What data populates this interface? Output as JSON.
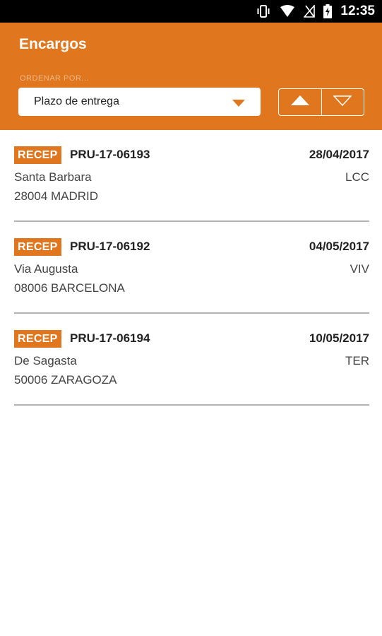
{
  "status_bar": {
    "icons": [
      "vibrate-icon",
      "wifi-icon",
      "no-signal-icon",
      "battery-charging-icon"
    ],
    "time": "12:35"
  },
  "header": {
    "title": "Encargos",
    "sort_label": "ORDENAR POR...",
    "sort_value": "Plazo de entrega",
    "ascending_icon": "triangle-up-filled-icon",
    "descending_icon": "triangle-down-outline-icon"
  },
  "colors": {
    "accent": "#e0761d",
    "status_bar": "#000000",
    "divider": "#b3b3b3"
  },
  "orders": [
    {
      "badge": "RECEP",
      "code": "PRU-17-06193",
      "date": "28/04/2017",
      "street": "Santa Barbara",
      "tag": "LCC",
      "city": "28004 MADRID"
    },
    {
      "badge": "RECEP",
      "code": "PRU-17-06192",
      "date": "04/05/2017",
      "street": "Via Augusta",
      "tag": "VIV",
      "city": "08006 BARCELONA"
    },
    {
      "badge": "RECEP",
      "code": "PRU-17-06194",
      "date": "10/05/2017",
      "street": "De Sagasta",
      "tag": "TER",
      "city": "50006 ZARAGOZA"
    }
  ]
}
